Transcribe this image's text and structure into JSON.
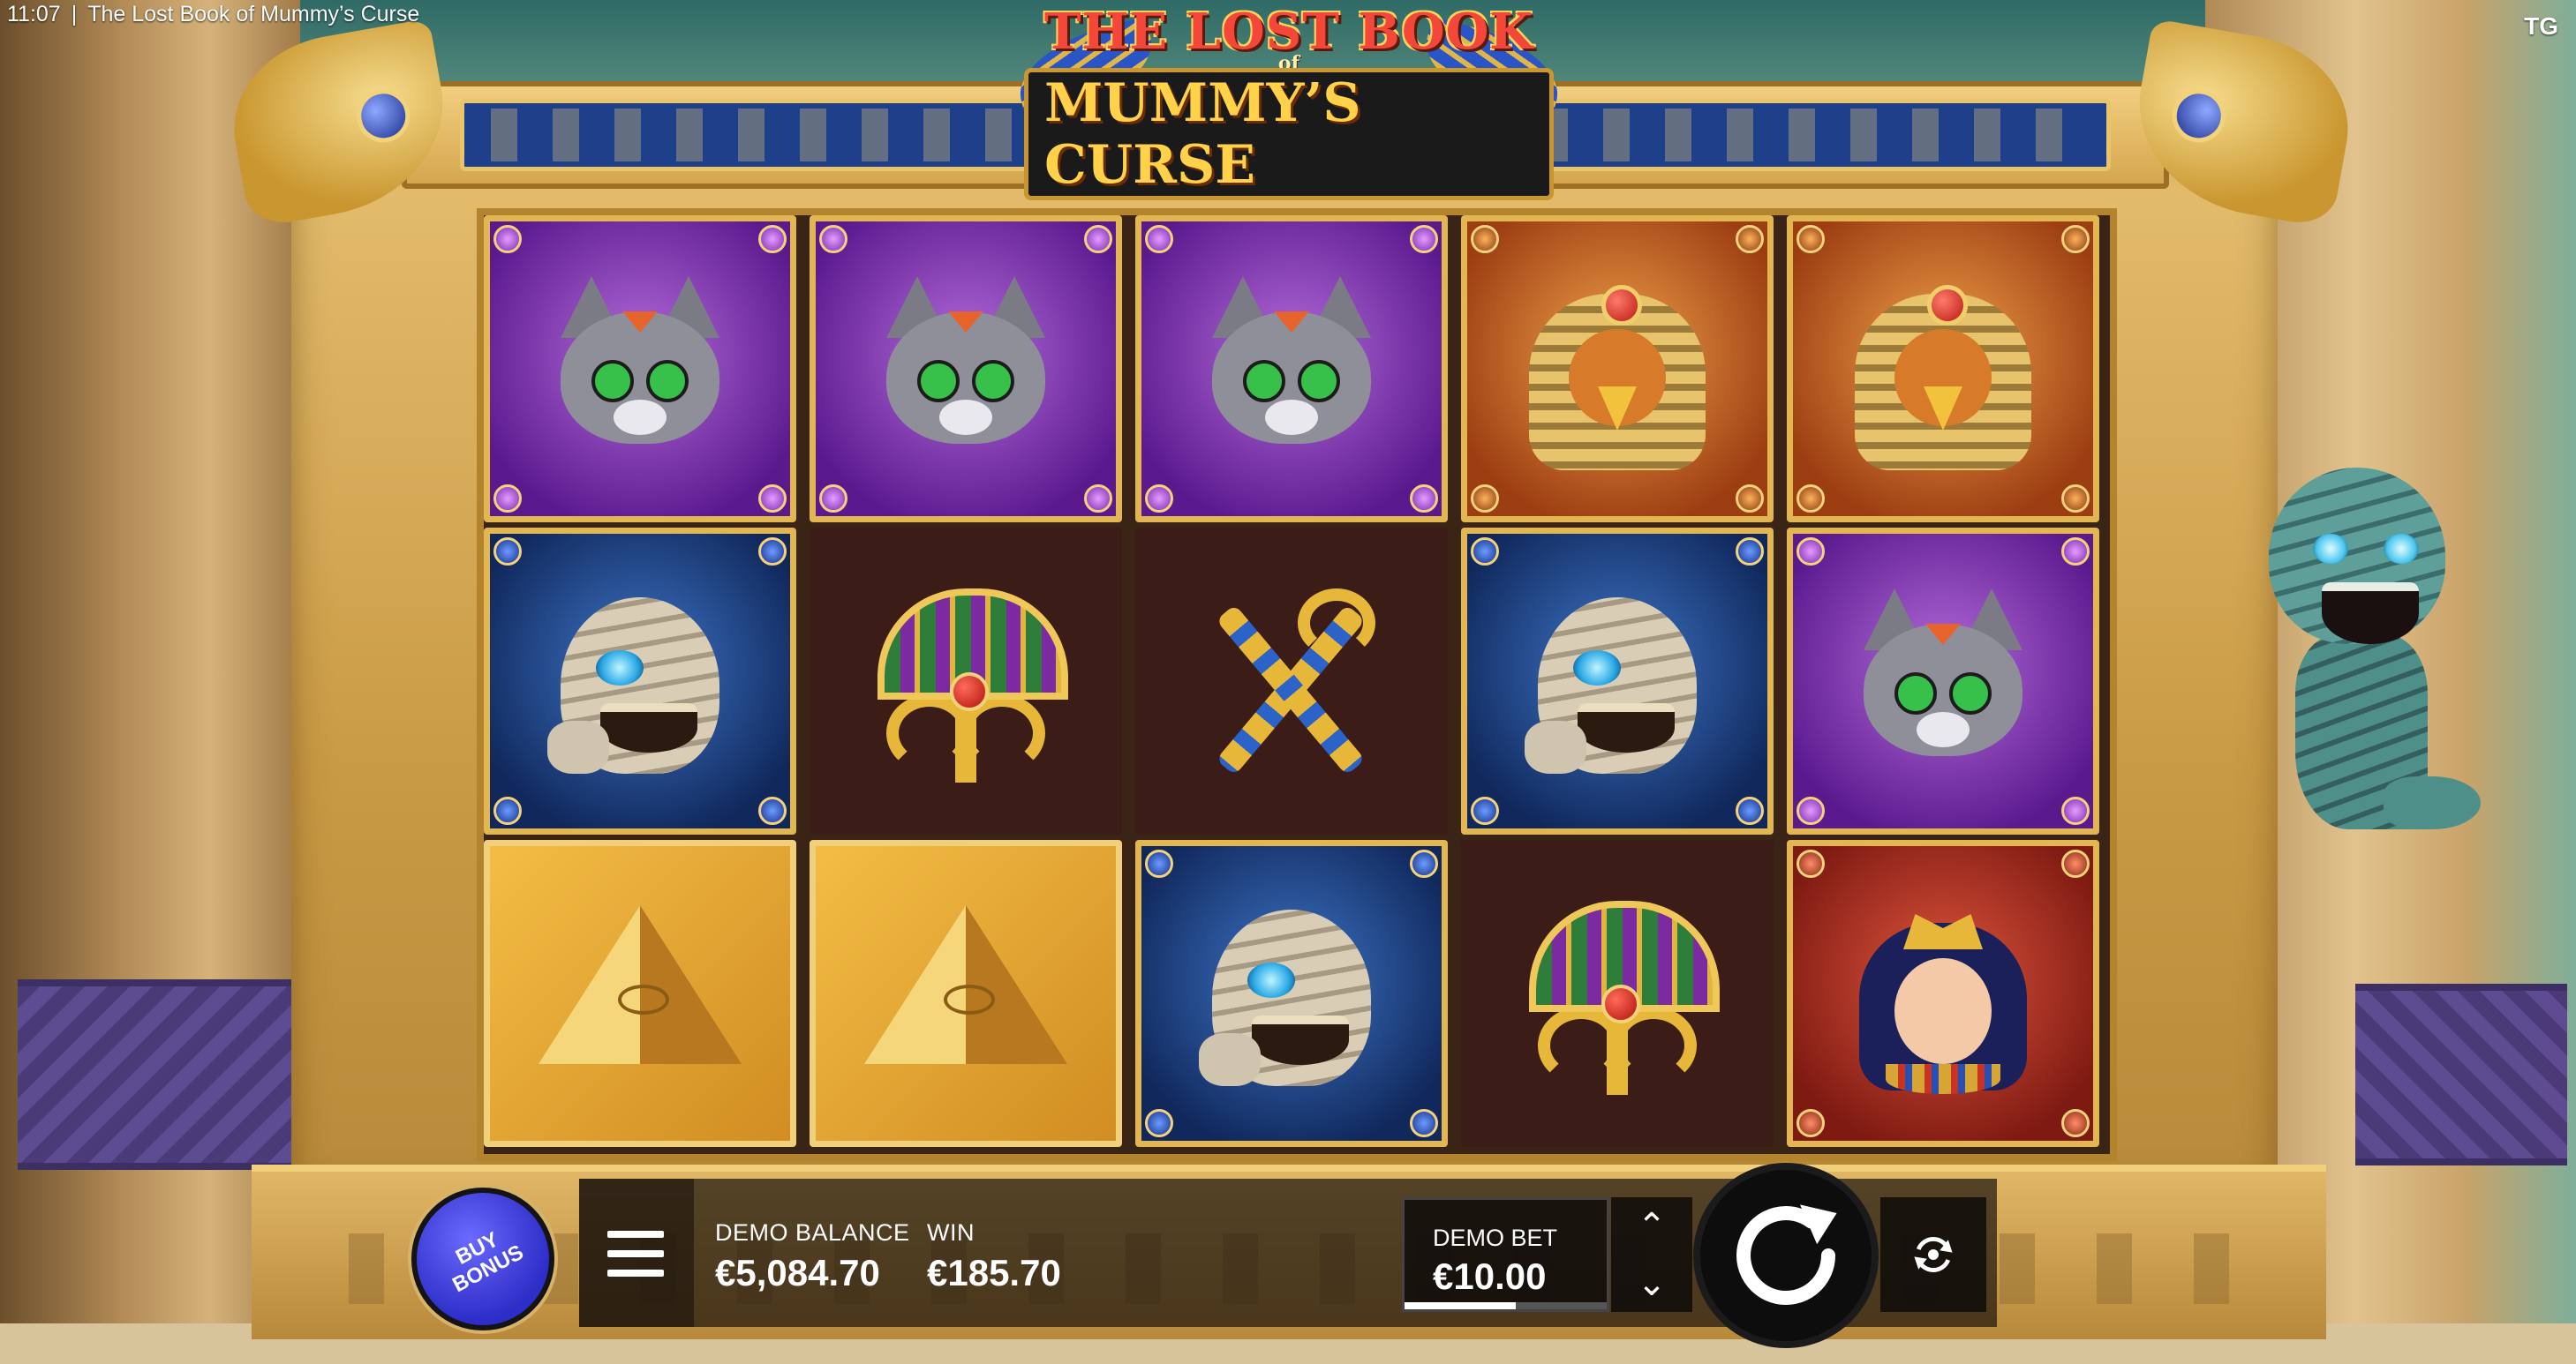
{
  "status_bar": {
    "time": "11:07",
    "separator": "|",
    "page_title": "The Lost Book of Mummy’s Curse",
    "provider_logo": "TG"
  },
  "game": {
    "logo_line1": "THE LOST BOOK",
    "logo_of": "of",
    "logo_line2": "MUMMY’S CURSE"
  },
  "reels": {
    "columns": [
      [
        "cat",
        "mummy",
        "pyramid"
      ],
      [
        "cat",
        "lotus-fan",
        "pyramid"
      ],
      [
        "cat",
        "crook-flail",
        "mummy"
      ],
      [
        "falcon-pharaoh",
        "mummy",
        "lotus-fan"
      ],
      [
        "falcon-pharaoh",
        "cat",
        "cleopatra"
      ]
    ]
  },
  "controls": {
    "buy_bonus_label": "BUY BONUS",
    "menu_icon": "hamburger-menu-icon",
    "balance_label": "DEMO BALANCE",
    "balance_value": "€5,084.70",
    "win_label": "WIN",
    "win_value": "€185.70",
    "bet_label": "DEMO BET",
    "bet_value": "€10.00",
    "bet_level_fraction": 0.55,
    "bet_up_icon": "chevron-up-icon",
    "bet_down_icon": "chevron-down-icon",
    "spin_icon": "spin-arrow-icon",
    "autoplay_icon": "autoplay-icon"
  },
  "colors": {
    "buy_bonus": "#3a3ae0",
    "frame_gold": "#d6a64f",
    "control_bg": "#1e160f"
  }
}
